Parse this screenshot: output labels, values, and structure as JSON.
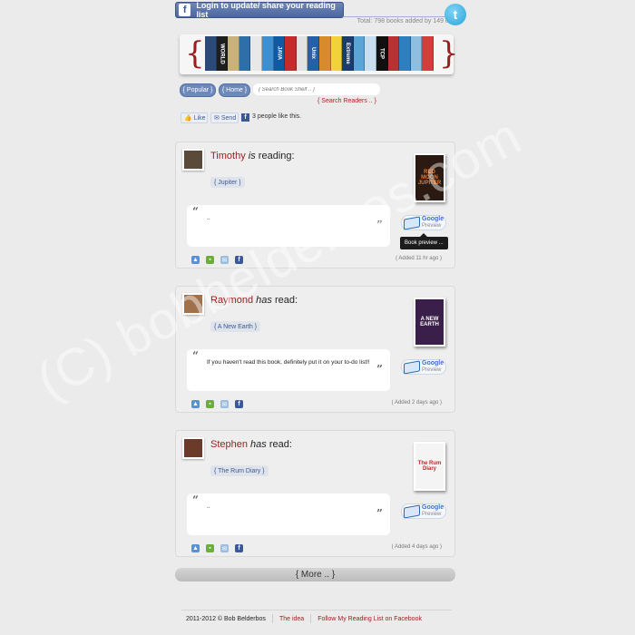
{
  "header": {
    "login_label": "Login to update/ share your reading list",
    "fb_letter": "f",
    "total_text": "Total: 798 books added by 149 users.",
    "twitter_letter": "t"
  },
  "banner": {
    "left_brace": "{",
    "right_brace": "}",
    "books": [
      {
        "title": "",
        "color": "#2b4a78"
      },
      {
        "title": "WORLD",
        "color": "#1e1e1e"
      },
      {
        "title": "",
        "color": "#c8b27a"
      },
      {
        "title": "",
        "color": "#2f6fa8"
      },
      {
        "title": "",
        "color": "#e8e8e8"
      },
      {
        "title": "",
        "color": "#3d8fcf"
      },
      {
        "title": "JAVA",
        "color": "#0f5aa3"
      },
      {
        "title": "",
        "color": "#c72a2a"
      },
      {
        "title": "",
        "color": "#e2e2e2"
      },
      {
        "title": "Unix",
        "color": "#2260a8"
      },
      {
        "title": "",
        "color": "#d98b2b"
      },
      {
        "title": "",
        "color": "#f2d23a"
      },
      {
        "title": "Extreme",
        "color": "#1a3d6e"
      },
      {
        "title": "",
        "color": "#5aa5d6"
      },
      {
        "title": "",
        "color": "#c9dff0"
      },
      {
        "title": "TCP",
        "color": "#101010"
      },
      {
        "title": "",
        "color": "#b73333"
      },
      {
        "title": "",
        "color": "#2e7fc0"
      },
      {
        "title": "",
        "color": "#8fbfe0"
      },
      {
        "title": "",
        "color": "#d43d3d"
      }
    ]
  },
  "nav": {
    "popular_label": "{ Popular }",
    "home_label": "{ Home }",
    "search_placeholder": "{ Search Book Shelf .. }",
    "search_readers_label": "{ Search Readers .. }"
  },
  "social": {
    "like_label": "Like",
    "send_label": "Send",
    "fb_letter": "f",
    "likes_text": "3 people like this."
  },
  "posts": [
    {
      "name": "Timothy",
      "verb": "is",
      "action": "reading:",
      "book_tag": "{ Jupiter }",
      "cover_text": "RED MOON JUPITER",
      "cover_color": "#2a1a12",
      "cover_text_color": "#e87a2a",
      "open_quote": "“",
      "close_quote": "”",
      "quote": "..",
      "gp_top": "Google",
      "gp_bottom": "Preview",
      "tooltip": "Book preview ...",
      "added": "( Added 11 hr ago )",
      "avatar_color": "#5a4a3a"
    },
    {
      "name": "Raymond",
      "verb": "has",
      "action": "read:",
      "book_tag": "{ A New Earth }",
      "cover_text": "A NEW EARTH",
      "cover_color": "#3a1f4a",
      "cover_text_color": "#ffffff",
      "open_quote": "“",
      "close_quote": "”",
      "quote": "If you haven't read this book, definitely put it on your to-do list!!",
      "gp_top": "Google",
      "gp_bottom": "Preview",
      "added": "( Added 2 days ago )",
      "avatar_color": "#a0714a"
    },
    {
      "name": "Stephen",
      "verb": "has",
      "action": "read:",
      "book_tag": "{ The Rum Diary }",
      "cover_text": "The Rum Diary",
      "cover_color": "#f4f4f4",
      "cover_text_color": "#c0292b",
      "open_quote": "“",
      "close_quote": "”",
      "quote": "..",
      "gp_top": "Google",
      "gp_bottom": "Preview",
      "added": "( Added 4 days ago )",
      "avatar_color": "#6b3a2a"
    }
  ],
  "more_label": "{ More .. }",
  "footer": {
    "copyright": "2011-2012 © Bob Belderbos",
    "idea_link": "The idea",
    "follow_link": "Follow My Reading List on Facebook"
  },
  "watermark": "(C) bobbelderbos.com",
  "colors": {
    "accent_red": "#9b1c1c",
    "fb_blue": "#3b5998"
  }
}
